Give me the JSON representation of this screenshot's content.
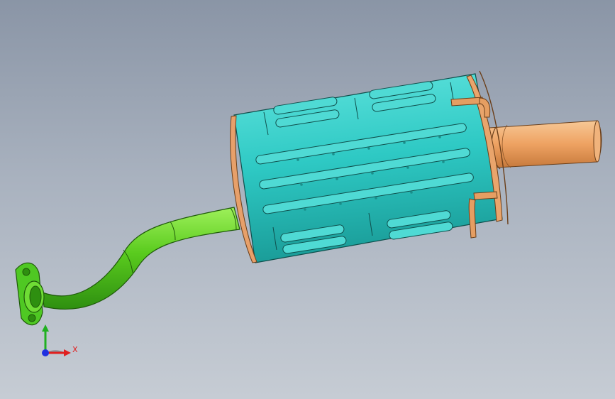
{
  "viewport": {
    "background_top": "#8a95a6",
    "background_bottom": "#c6ccd4"
  },
  "model": {
    "parts": [
      {
        "name": "front-flange",
        "color": "#3fbf1c"
      },
      {
        "name": "inlet-pipe",
        "color": "#58cc1c"
      },
      {
        "name": "muffler-body",
        "color": "#2ec9c4"
      },
      {
        "name": "end-cap",
        "color": "#e9a56c"
      },
      {
        "name": "tailpipe",
        "color": "#efa463"
      },
      {
        "name": "hanger-brackets",
        "color": "#e59e62"
      }
    ]
  },
  "triad": {
    "x_label": "X",
    "x_color": "#e02020",
    "y_color": "#20b020",
    "z_color": "#2030e0"
  }
}
